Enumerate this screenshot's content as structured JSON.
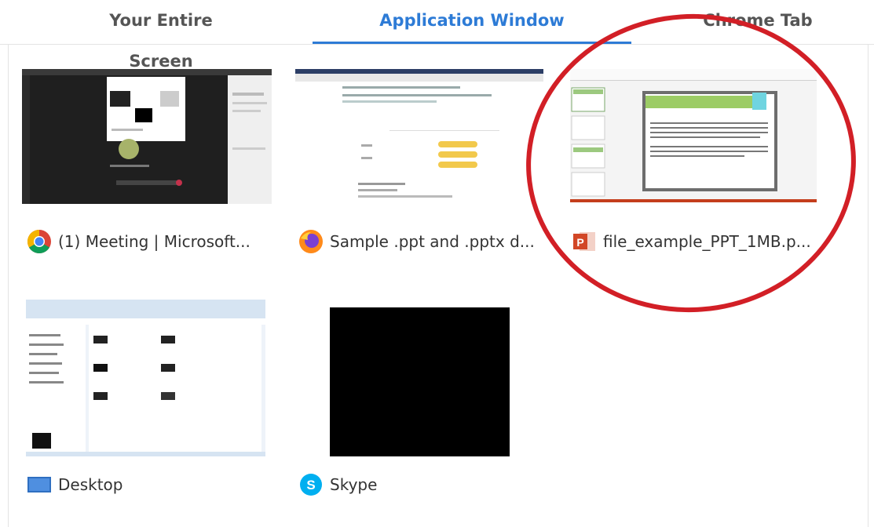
{
  "tabs": [
    {
      "label": "Your Entire Screen",
      "active": false
    },
    {
      "label": "Application Window",
      "active": true
    },
    {
      "label": "Chrome Tab",
      "active": false
    }
  ],
  "windows": [
    {
      "label": "(1) Meeting | Microsoft...",
      "icon": "chrome-icon"
    },
    {
      "label": "Sample .ppt and .pptx d...",
      "icon": "firefox-icon"
    },
    {
      "label": "file_example_PPT_1MB.p...",
      "icon": "powerpoint-icon"
    },
    {
      "label": "Desktop",
      "icon": "desktop-icon"
    },
    {
      "label": "Skype",
      "icon": "skype-icon"
    }
  ],
  "colors": {
    "accent": "#2d7bd6",
    "annotation": "#d21f26"
  }
}
